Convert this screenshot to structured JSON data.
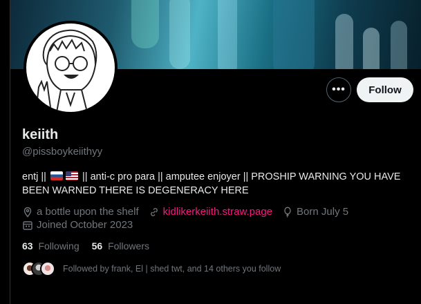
{
  "profile": {
    "display_name": "keiith",
    "handle": "@pissboykeiithyy",
    "bio_part1": "entj ||",
    "bio_part2": "|| anti-c pro para || amputee enjoyer || PROSHIP WARNING YOU HAVE BEEN WARNED THERE IS DEGENERACY HERE",
    "location": "a bottle upon the shelf",
    "website": "kidlikerkeiith.straw.page",
    "birthday": "Born July 5",
    "joined": "Joined October 2023"
  },
  "stats": {
    "following_count": "63",
    "following_label": "Following",
    "followers_count": "56",
    "followers_label": "Followers"
  },
  "followed_by": "Followed by frank, El | shed twt, and 14 others you follow",
  "actions": {
    "more_label": "•••",
    "follow_label": "Follow"
  },
  "colors": {
    "background": "#000000",
    "text": "#e7e9ea",
    "muted": "#71767b",
    "link": "#f91880",
    "follow_button_bg": "#eff3f4"
  },
  "icons": [
    "more-icon",
    "location-icon",
    "link-icon",
    "balloon-icon",
    "calendar-icon",
    "flag-russia-icon",
    "flag-usa-icon"
  ]
}
